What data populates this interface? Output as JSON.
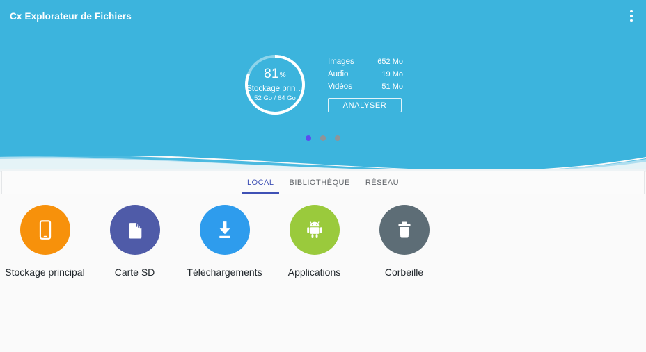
{
  "app": {
    "title": "Cx Explorateur de Fichiers",
    "overflow_icon": "more-vertical-icon"
  },
  "storage_card": {
    "donut": {
      "percent_value": "81",
      "percent_unit": "%",
      "percent_fill": 81,
      "name": "Stockage prin…",
      "size_text": "52 Go / 64 Go",
      "used": "52 Go",
      "total": "64 Go",
      "ring_color": "#ffffff",
      "track_color": "#8ed4ea"
    },
    "stats": [
      {
        "label": "Images",
        "value": "652 Mo"
      },
      {
        "label": "Audio",
        "value": "19 Mo"
      },
      {
        "label": "Vidéos",
        "value": "51 Mo"
      }
    ],
    "analyse_label": "ANALYSER"
  },
  "pager": {
    "count": 3,
    "active_index": 0,
    "active_color": "#5b4df0",
    "inactive_color": "#8e9499"
  },
  "tabs": {
    "active_index": 0,
    "accent_color": "#3f51b5",
    "items": [
      {
        "label": "LOCAL"
      },
      {
        "label": "BIBLIOTHÈQUE"
      },
      {
        "label": "RÉSEAU"
      }
    ]
  },
  "shortcuts": [
    {
      "label": "Stockage principal",
      "icon": "phone-icon",
      "color": "#f7910b"
    },
    {
      "label": "Carte SD",
      "icon": "sd-card-icon",
      "color": "#4f5ba8"
    },
    {
      "label": "Téléchargements",
      "icon": "download-icon",
      "color": "#2e9ced"
    },
    {
      "label": "Applications",
      "icon": "android-icon",
      "color": "#9aca3c"
    },
    {
      "label": "Corbeille",
      "icon": "trash-icon",
      "color": "#5d6d76"
    }
  ],
  "theme": {
    "header_color": "#3cb4dd",
    "wave_light_color": "#bfe4f2",
    "page_background": "#fafafa"
  }
}
